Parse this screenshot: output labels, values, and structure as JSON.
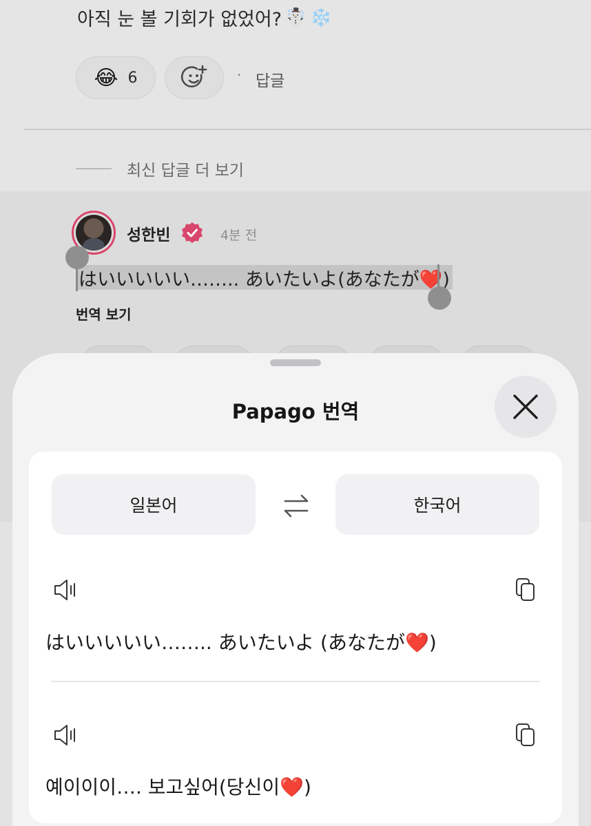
{
  "comment": {
    "text": "아직 눈 볼 기회가 없었어?",
    "emojis": [
      "☃️",
      "❄️"
    ]
  },
  "reactions": {
    "emoji": "😂",
    "count": "6",
    "add_icon": "add-reaction-icon",
    "separator": "·",
    "reply_label": "답글"
  },
  "thread": {
    "more_replies_label": "최신 답글 더 보기"
  },
  "reply": {
    "author": "성한빈",
    "verified_icon": "verified-badge-icon",
    "verified_color": "#d9466b",
    "time": "4분 전",
    "text": "はいいいいい…….. あいたいよ(あなたが❤️)",
    "translate_label": "번역 보기"
  },
  "sheet": {
    "title": "Papago 번역",
    "close_icon": "close-icon",
    "source_language": "일본어",
    "target_language": "한국어",
    "swap_icon": "swap-arrows-icon",
    "source_text": "はいいいいい…….. あいたいよ (あなたが❤️)",
    "translated_text": "예이이이…. 보고싶어(당신이❤️)",
    "speaker_icon": "speaker-icon",
    "copy_icon": "copy-icon"
  }
}
